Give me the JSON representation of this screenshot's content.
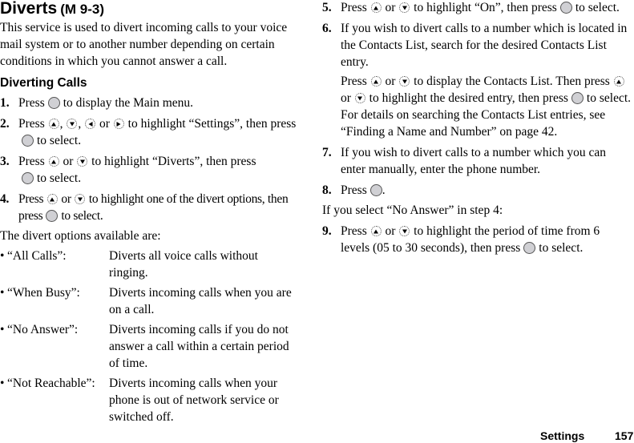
{
  "title": "Diverts",
  "menu_ref": "(M 9-3)",
  "intro": "This service is used to divert incoming calls to your voice mail system or to another number depending on certain conditions in which you cannot answer a call.",
  "section_heading": "Diverting Calls",
  "steps": {
    "s1": {
      "num": "1.",
      "a": "Press",
      "b": "to display the Main menu."
    },
    "s2": {
      "num": "2.",
      "a": "Press",
      "sep1": ",",
      "sep2": ",",
      "or": "or",
      "b": "to highlight “Settings”, then press",
      "c": "to select."
    },
    "s3": {
      "num": "3.",
      "a": "Press",
      "or": "or",
      "b": "to highlight “Diverts”, then press",
      "c": "to select."
    },
    "s4": {
      "num": "4.",
      "a": "Press",
      "or": "or",
      "b": "to highlight one of the divert options, then press",
      "c": "to select."
    },
    "s5": {
      "num": "5.",
      "a": "Press",
      "or": "or",
      "b": "to highlight “On”, then press",
      "c": "to select."
    },
    "s6": {
      "num": "6.",
      "text": "If you wish to divert calls to a number which is located in the Contacts List, search for the desired Contacts List entry.",
      "a": "Press",
      "or": "or",
      "b": "to display the Contacts List. Then press",
      "or2": "or",
      "c": "to highlight the desired entry, then press",
      "d": "to select. For details on searching the Contacts List entries, see “Finding a Name and Number” on page 42."
    },
    "s7": {
      "num": "7.",
      "text": "If you wish to divert calls to a number which you can enter manually, enter the phone number."
    },
    "s8": {
      "num": "8.",
      "a": "Press",
      "b": "."
    },
    "s9": {
      "num": "9.",
      "a": "Press",
      "or": "or",
      "b": "to highlight the period of time from 6 levels (05 to 30 seconds), then press",
      "c": "to select."
    }
  },
  "options_intro": "The divert options available are:",
  "options": [
    {
      "bullet": "•",
      "label": "“All Calls”:",
      "desc": "Diverts all voice calls without ringing."
    },
    {
      "bullet": "•",
      "label": "“When Busy”:",
      "desc": "Diverts incoming calls when you are on a call."
    },
    {
      "bullet": "•",
      "label": "“No Answer”:",
      "desc": "Diverts incoming calls if you do not answer a call within a certain period of time."
    },
    {
      "bullet": "•",
      "label": "“Not Reachable”:",
      "desc": "Diverts incoming calls when your phone is out of network service or switched off."
    }
  ],
  "no_answer_note": "If you select “No Answer” in step 4:",
  "footer": {
    "section": "Settings",
    "page": "157"
  },
  "icons": {
    "center_key": "center-key-icon",
    "up": "up-arrow-key-icon",
    "down": "down-arrow-key-icon",
    "left": "left-arrow-key-icon",
    "right": "right-arrow-key-icon"
  }
}
